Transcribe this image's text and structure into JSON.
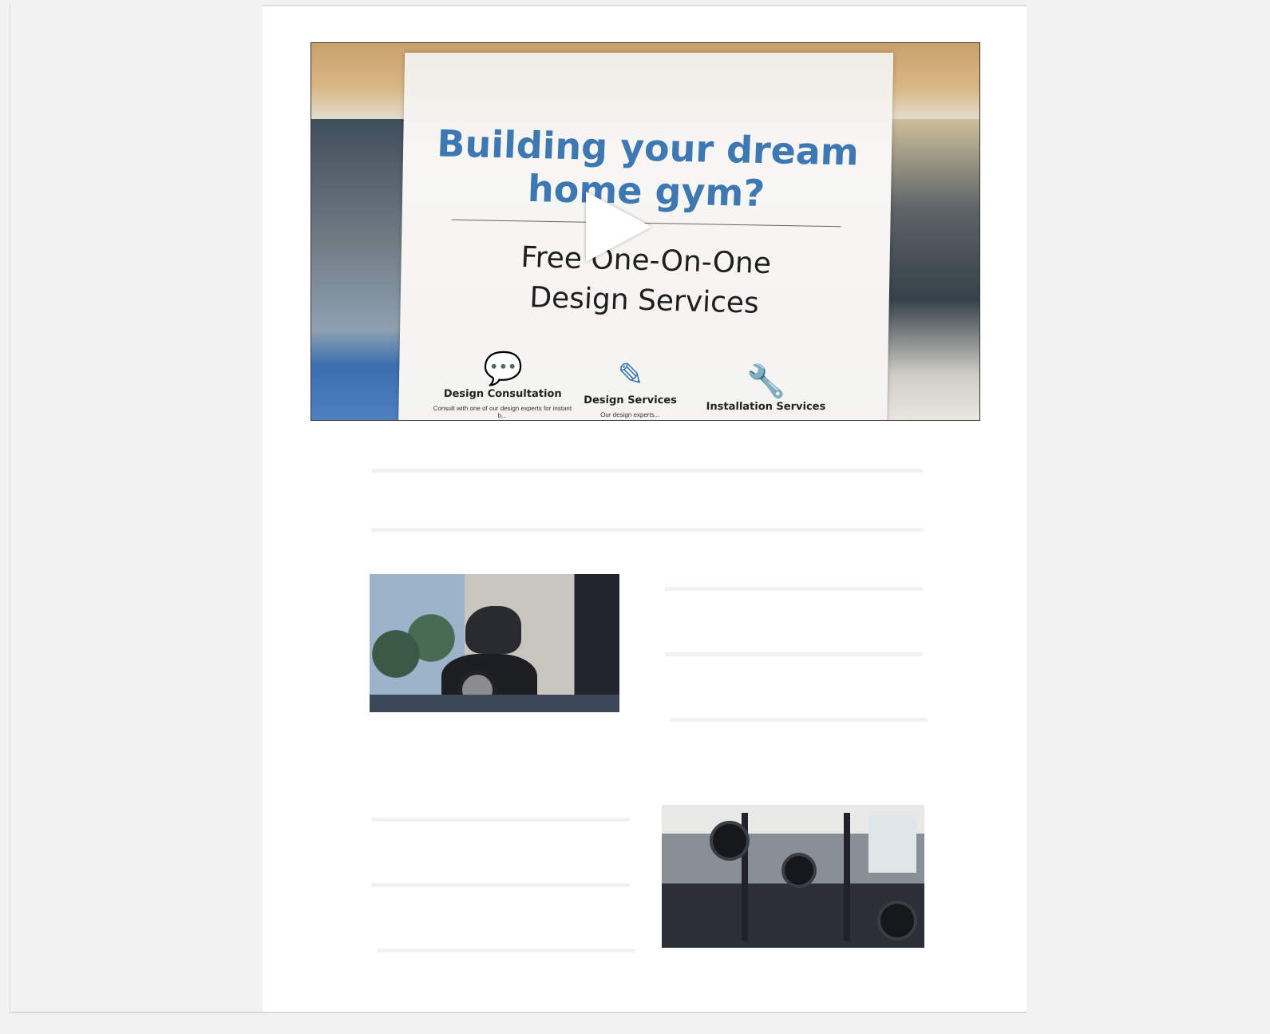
{
  "video": {
    "title_line1": "Building your dream",
    "title_line2": "home gym?",
    "subtitle_line1": "Free One-On-One",
    "subtitle_line2": "Design Services",
    "services": [
      {
        "label": "Design Consultation",
        "desc": "Consult with one of our design experts for instant b...",
        "icon": "chat-bubbles-icon"
      },
      {
        "label": "Design Services",
        "desc": "Our design experts...",
        "icon": "edit-icon"
      },
      {
        "label": "Installation Services",
        "desc": "",
        "icon": "wrench-icon"
      }
    ],
    "play_icon": "play-icon"
  },
  "colors": {
    "page_bg": "#f2f2f2",
    "card_bg": "#ffffff",
    "placeholder": "#f2f2f2",
    "sign_blue": "#3e78b3"
  },
  "images": {
    "bike": "woman on indoor exercise bike by window",
    "gym": "home gym power rack with weight plates"
  }
}
